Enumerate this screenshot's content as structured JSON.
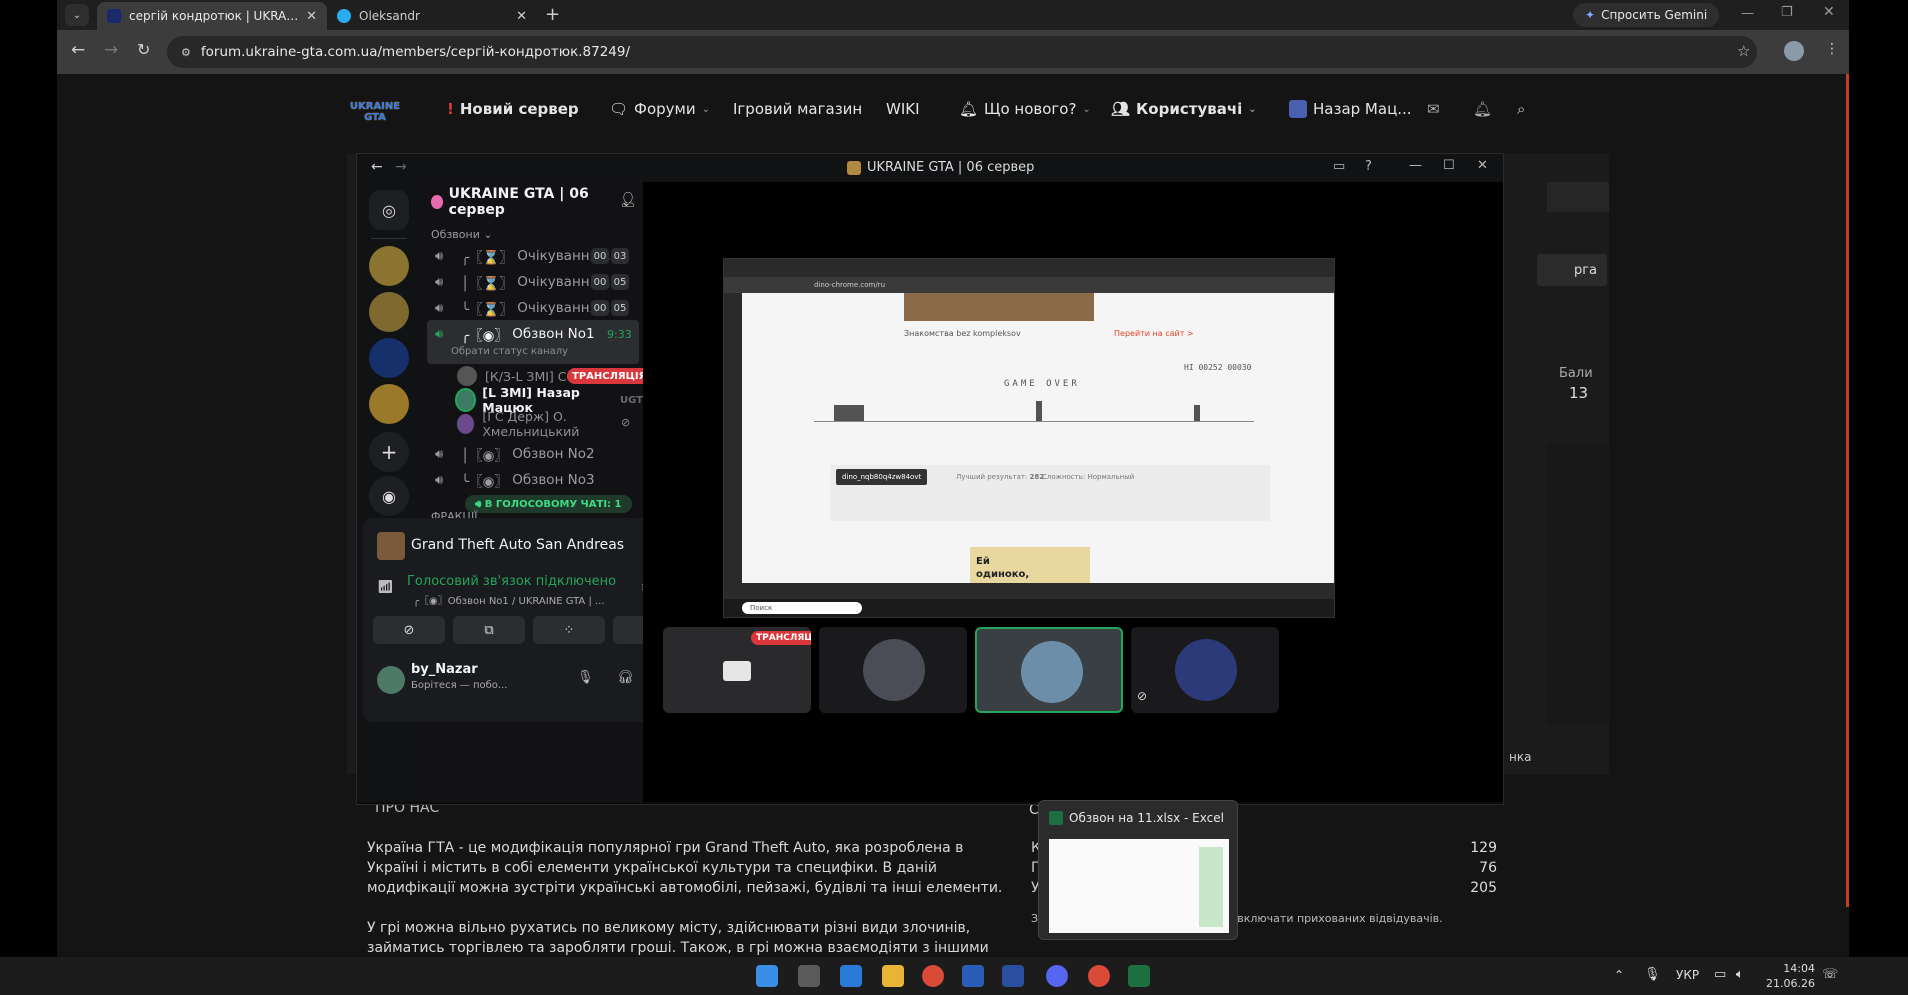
{
  "browser": {
    "tabs": [
      {
        "title": "сергій кондротюк | UKRAINE G",
        "active": true
      },
      {
        "title": "Oleksandr",
        "active": false
      }
    ],
    "gemini_label": "Спросить Gemini",
    "url": "forum.ukraine-gta.com.ua/members/сергій-кондротюк.87249/"
  },
  "site": {
    "logo": "UKRAINE GTA",
    "nav": {
      "new_server": "Новий сервер",
      "forums": "Форуми",
      "shop": "Ігровий магазин",
      "wiki": "WIKI",
      "whats_new": "Що нового?",
      "users": "Користувачі",
      "user": "Назар Мац..."
    },
    "right_snippets": {
      "btn": "рга",
      "points_label": "Бали",
      "points_value": "13",
      "link": "нка"
    },
    "about": {
      "heading": "ПРО НАС",
      "p1_l1": "Україна ГТА - це модифікація популярної гри Grand Theft Auto, яка розроблена в",
      "p1_l2": "Україні і містить в собі елементи української культури та специфіки. В даній",
      "p1_l3": "модифікації можна зустріти українські автомобілі, пейзажі, будівлі та інші елементи.",
      "p2_l1": "У грі можна вільно рухатись по великому місту, здійснювати різні види злочинів,",
      "p2_l2": "займатись торгівлею та заробляти гроші. Також, в грі можна взаємодіяти з іншими"
    },
    "stats": {
      "v1": "129",
      "v2": "76",
      "v3": "205",
      "letters": [
        "С",
        "К",
        "П",
        "У"
      ],
      "note_prefix": "З",
      "note": "е включати прихованих відвідувачів."
    }
  },
  "discord": {
    "window_title": "UKRAINE GTA | 06 сервер",
    "server_name": "UKRAINE GTA | 06 сервер",
    "category": "Обзвони",
    "channels": [
      {
        "prefix": "╭〖⌛〗",
        "name": "Очікування ...",
        "b1": "00",
        "b2": "03"
      },
      {
        "prefix": "│〖⌛〗",
        "name": "Очікування ...",
        "b1": "00",
        "b2": "05"
      },
      {
        "prefix": "╰〖⌛〗",
        "name": "Очікування ...",
        "b1": "00",
        "b2": "05"
      }
    ],
    "active_channel": {
      "prefix": "╭〖◉〗",
      "name": "Обзвон No1",
      "time": "9:33",
      "status": "Обрати статус каналу"
    },
    "members": [
      {
        "name": "[К/З-L ЗМІ] Се...",
        "tag": "ТРАНСЛЯЦІЯ"
      },
      {
        "name": "[L ЗМІ] Назар Мацюк",
        "tag": "UGT"
      },
      {
        "name": "[ГС Держ] О. Хмельницький",
        "tag": ""
      }
    ],
    "channels2": [
      {
        "prefix": "│〖◉〗",
        "name": "Обзвон No2"
      },
      {
        "prefix": "╰〖◉〗",
        "name": "Обзвон No3"
      }
    ],
    "voice_chat_pill": "В ГОЛОСОВОМУ ЧАТІ: 1",
    "category2": "ФРАКЦІЇ",
    "activity": "Grand Theft Auto San Andreas",
    "voice_connected": "Голосовий зв'язок підключено",
    "voice_channel": "╭〖◉〗Обзвон No1 / UKRAINE GTA | ...",
    "user_name": "by_Nazar",
    "user_status": "Борітеся — побо...",
    "live_tag": "ТРАНСЛЯЦІЯ"
  },
  "stream": {
    "url": "dino-chrome.com/ru",
    "ad_text": "Знакомства bez kompleksov",
    "ad_link": "Перейти на сайт >",
    "game_over": "GAME OVER",
    "score": "HI 00252 00030",
    "player": "dino_nqb80q4zw84ovt",
    "best_label": "Лучший результат:",
    "best": "282",
    "difficulty_label": "Сложность:",
    "difficulty": "Нормальный",
    "ad2_l1": "Ей",
    "ad2_l2": "одиноко,",
    "taskbar_search": "Поиск"
  },
  "excel_preview": {
    "title": "Обзвон на 11.xlsx - Excel"
  },
  "taskbar": {
    "lang": "УКР",
    "time": "14:04",
    "date": "21.06.26"
  },
  "colors": {
    "discord_green": "#23a55a",
    "live_red": "#da373c",
    "brand_blue": "#5865f2"
  }
}
